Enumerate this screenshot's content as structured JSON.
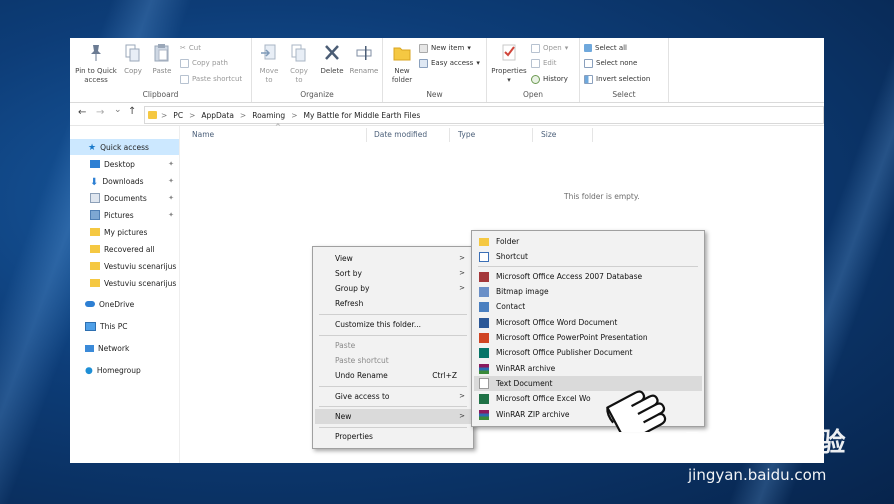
{
  "ribbon": {
    "clipboard": {
      "pin": "Pin to Quick\naccess",
      "copy": "Copy",
      "paste": "Paste",
      "cut": "Cut",
      "copy_path": "Copy path",
      "paste_shortcut": "Paste shortcut",
      "label": "Clipboard"
    },
    "organize": {
      "move_to": "Move\nto",
      "copy_to": "Copy\nto",
      "delete": "Delete",
      "rename": "Rename",
      "label": "Organize"
    },
    "new": {
      "new_folder": "New\nfolder",
      "new_item": "New item",
      "easy_access": "Easy access",
      "label": "New"
    },
    "open": {
      "properties": "Properties",
      "open": "Open",
      "edit": "Edit",
      "history": "History",
      "label": "Open"
    },
    "select": {
      "select_all": "Select all",
      "select_none": "Select none",
      "invert": "Invert selection",
      "label": "Select"
    }
  },
  "address": {
    "crumbs": [
      "PC",
      "AppData",
      "Roaming",
      "My Battle for Middle Earth Files"
    ],
    "sep": ">",
    "back": "←",
    "forward": "→",
    "recent": "⌄",
    "up": "↑"
  },
  "nav": {
    "items": [
      {
        "label": "Quick access",
        "icon": "star-icon",
        "pinned": false
      },
      {
        "label": "Desktop",
        "icon": "desktop-icon",
        "pinned": true
      },
      {
        "label": "Downloads",
        "icon": "download-icon",
        "pinned": true
      },
      {
        "label": "Documents",
        "icon": "documents-icon",
        "pinned": true
      },
      {
        "label": "Pictures",
        "icon": "pictures-icon",
        "pinned": true
      },
      {
        "label": "My pictures",
        "icon": "folder-icon",
        "pinned": false
      },
      {
        "label": "Recovered all",
        "icon": "folder-icon",
        "pinned": false
      },
      {
        "label": "Vestuviu scenarijus",
        "icon": "folder-icon",
        "pinned": false
      },
      {
        "label": "Vestuviu scenarijus",
        "icon": "folder-icon",
        "pinned": false
      },
      {
        "label": "OneDrive",
        "icon": "cloud-icon",
        "pinned": false
      },
      {
        "label": "This PC",
        "icon": "pc-icon",
        "pinned": false
      },
      {
        "label": "Network",
        "icon": "network-icon",
        "pinned": false
      },
      {
        "label": "Homegroup",
        "icon": "homegroup-icon",
        "pinned": false
      }
    ]
  },
  "content": {
    "columns": [
      "Name",
      "Date modified",
      "Type",
      "Size"
    ],
    "sort_glyph": "^",
    "empty_text": "This folder is empty."
  },
  "context_menu": {
    "items": [
      {
        "label": "View",
        "submenu": true
      },
      {
        "label": "Sort by",
        "submenu": true
      },
      {
        "label": "Group by",
        "submenu": true
      },
      {
        "label": "Refresh"
      },
      {
        "label": "Customize this folder..."
      },
      {
        "label": "Paste",
        "disabled": true
      },
      {
        "label": "Paste shortcut",
        "disabled": true
      },
      {
        "label": "Undo Rename",
        "shortcut": "Ctrl+Z"
      },
      {
        "label": "Give access to",
        "submenu": true
      },
      {
        "label": "New",
        "submenu": true,
        "highlighted": true
      },
      {
        "label": "Properties"
      }
    ],
    "arrow_glyph": ">"
  },
  "new_submenu": {
    "items": [
      {
        "label": "Folder",
        "icon": "folder-icon",
        "color": "#f5c842"
      },
      {
        "label": "Shortcut",
        "icon": "shortcut-icon",
        "color": "#3b6fb6"
      },
      {
        "label": "Microsoft Office Access 2007 Database",
        "icon": "access-icon",
        "color": "#a4373a"
      },
      {
        "label": "Bitmap image",
        "icon": "bitmap-icon",
        "color": "#6a8fc7"
      },
      {
        "label": "Contact",
        "icon": "contact-icon",
        "color": "#4a7fc0"
      },
      {
        "label": "Microsoft Office Word Document",
        "icon": "word-icon",
        "color": "#2b5797"
      },
      {
        "label": "Microsoft Office PowerPoint Presentation",
        "icon": "powerpoint-icon",
        "color": "#d04423"
      },
      {
        "label": "Microsoft Office Publisher Document",
        "icon": "publisher-icon",
        "color": "#077568"
      },
      {
        "label": "WinRAR archive",
        "icon": "winrar-icon",
        "color": "#8b1a5e"
      },
      {
        "label": "Text Document",
        "icon": "text-icon",
        "color": "#9a9a9a",
        "highlighted": true
      },
      {
        "label": "Microsoft Office Excel Wo",
        "icon": "excel-icon",
        "color": "#1e7145"
      },
      {
        "label": "WinRAR ZIP archive",
        "icon": "winrar-zip-icon",
        "color": "#8b1a5e"
      }
    ]
  },
  "watermark": {
    "brand": "Bai du 经验",
    "url": "jingyan.baidu.com"
  },
  "colors": {
    "accent": "#1979ca",
    "selected_nav": "#cce8ff",
    "menu_bg": "#f2f2f2"
  }
}
